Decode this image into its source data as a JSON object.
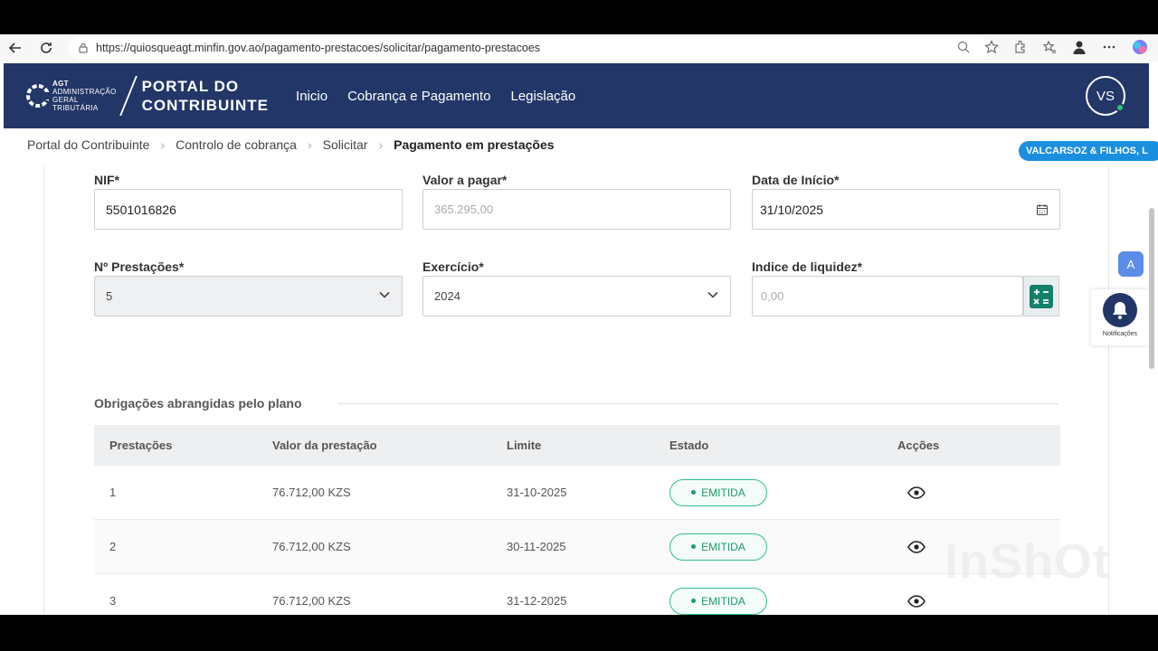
{
  "browser": {
    "url": "https://quiosqueagt.minfin.gov.ao/pagamento-prestacoes/solicitar/pagamento-prestacoes"
  },
  "header": {
    "logo_small_1": "AGT",
    "logo_small_2": "ADMINISTRAÇÃO",
    "logo_small_3": "GERAL",
    "logo_small_4": "TRIBUTÁRIA",
    "logo_big_1": "PORTAL DO",
    "logo_big_2": "CONTRIBUINTE",
    "nav": [
      "Inicio",
      "Cobrança e Pagamento",
      "Legislação"
    ],
    "avatar_initials": "VS"
  },
  "breadcrumb": [
    "Portal do Contribuinte",
    "Controlo de cobrança",
    "Solicitar",
    "Pagamento em prestações"
  ],
  "company_badge": "VALCARSOZ & FILHOS, L",
  "form": {
    "nif_label": "NIF*",
    "nif_value": "5501016826",
    "valor_label": "Valor a pagar*",
    "valor_value": "365.295,00",
    "data_label": "Data de Início*",
    "data_value": "31/10/2025",
    "prestacoes_label": "Nº Prestações*",
    "prestacoes_value": "5",
    "exercicio_label": "Exercício*",
    "exercicio_value": "2024",
    "liquidez_label": "Indice de liquidez*",
    "liquidez_placeholder": "0,00"
  },
  "section_title": "Obrigações abrangidas pelo plano",
  "table": {
    "headers": [
      "Prestações",
      "Valor da prestação",
      "Limite",
      "Estado",
      "Acções"
    ],
    "rows": [
      {
        "n": "1",
        "valor": "76.712,00 KZS",
        "limite": "31-10-2025",
        "estado": "EMITIDA"
      },
      {
        "n": "2",
        "valor": "76.712,00 KZS",
        "limite": "30-11-2025",
        "estado": "EMITIDA"
      },
      {
        "n": "3",
        "valor": "76.712,00 KZS",
        "limite": "31-12-2025",
        "estado": "EMITIDA"
      }
    ]
  },
  "notifications_label": "Notificações",
  "translate_label": "A",
  "watermark": "InShOt",
  "colors": {
    "header_bg": "#233668",
    "status_green": "#1f9a69",
    "badge_blue": "#1a8fe0"
  }
}
